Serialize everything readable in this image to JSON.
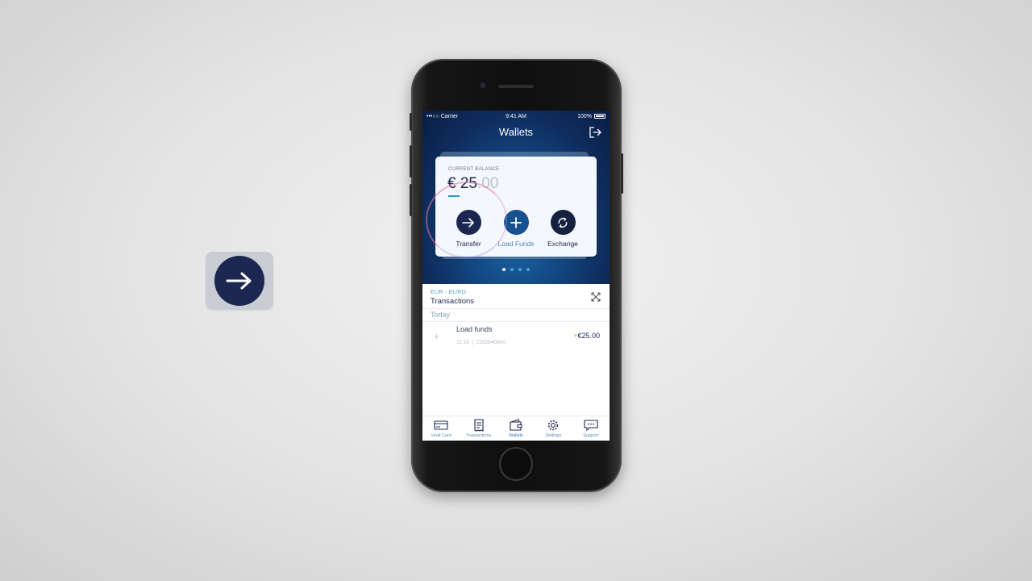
{
  "floating_icon": {
    "name": "arrow-right-icon",
    "color": "#1b2750"
  },
  "status_bar": {
    "carrier": "•••○○ Carrier",
    "time": "9:41 AM",
    "battery": "100%"
  },
  "header": {
    "title": "Wallets"
  },
  "balance_card": {
    "label": "CURRENT BALANCE",
    "currency_symbol": "€",
    "amount_int": "25",
    "amount_dec": ".00",
    "actions": [
      {
        "label": "Transfer",
        "icon": "arrow-right-icon"
      },
      {
        "label": "Load Funds",
        "icon": "plus-icon"
      },
      {
        "label": "Exchange",
        "icon": "exchange-icon"
      }
    ]
  },
  "pagination": {
    "count": 4,
    "active_index": 0
  },
  "transactions": {
    "currency": "EUR - EURO",
    "title": "Transactions",
    "group_label": "Today",
    "items": [
      {
        "name": "Load funds",
        "time": "11:19",
        "ref": "2282640900",
        "sign": "+",
        "amount": "€25.00"
      }
    ]
  },
  "tabbar": {
    "items": [
      {
        "label": "Vault Card",
        "icon": "card-icon"
      },
      {
        "label": "Transactions",
        "icon": "receipt-icon"
      },
      {
        "label": "Wallets",
        "icon": "wallet-icon"
      },
      {
        "label": "Settings",
        "icon": "gear-icon"
      },
      {
        "label": "Support",
        "icon": "chat-icon"
      }
    ],
    "active": "Wallets"
  },
  "colors": {
    "navy": "#1b2750",
    "accent": "#1ea3c6",
    "positive": "#8fbc3c"
  }
}
